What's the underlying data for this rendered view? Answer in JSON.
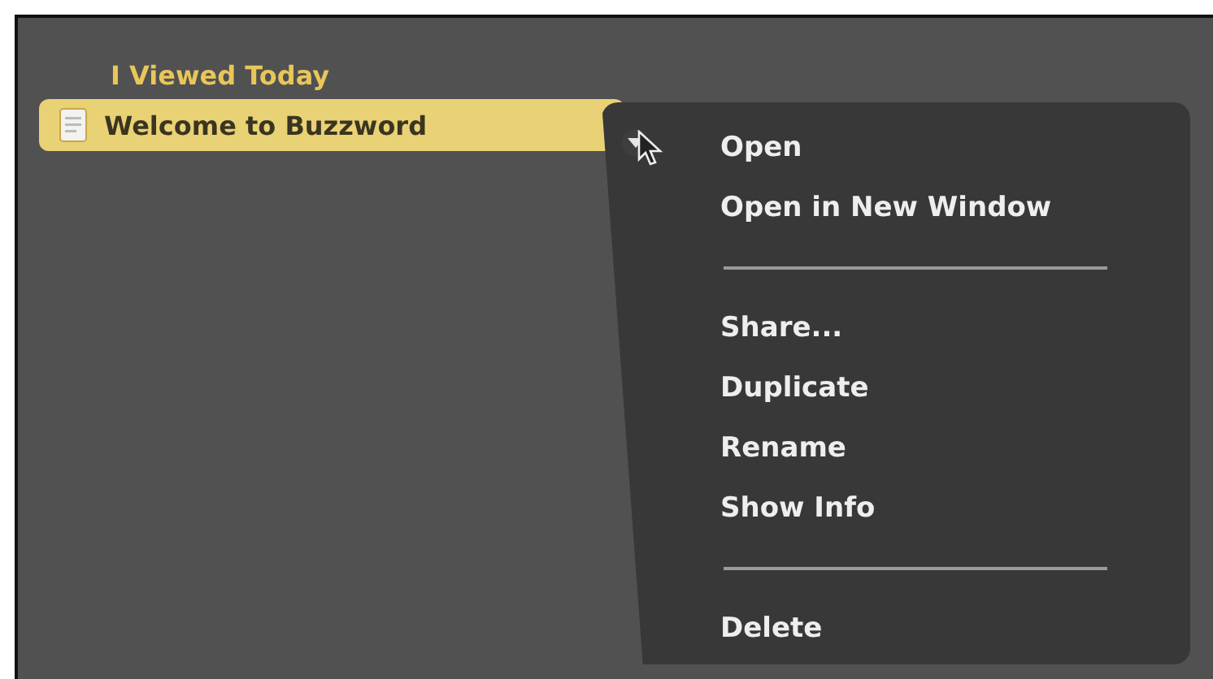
{
  "recent": {
    "heading": "I Viewed Today",
    "documents": [
      {
        "name": "Welcome to Buzzword",
        "selected": true
      }
    ]
  },
  "context_menu": {
    "items": [
      {
        "kind": "item",
        "label": "Open"
      },
      {
        "kind": "item",
        "label": "Open in New Window"
      },
      {
        "kind": "separator"
      },
      {
        "kind": "item",
        "label": "Share..."
      },
      {
        "kind": "item",
        "label": "Duplicate"
      },
      {
        "kind": "item",
        "label": "Rename"
      },
      {
        "kind": "item",
        "label": "Show Info"
      },
      {
        "kind": "separator"
      },
      {
        "kind": "item",
        "label": "Delete"
      }
    ]
  }
}
